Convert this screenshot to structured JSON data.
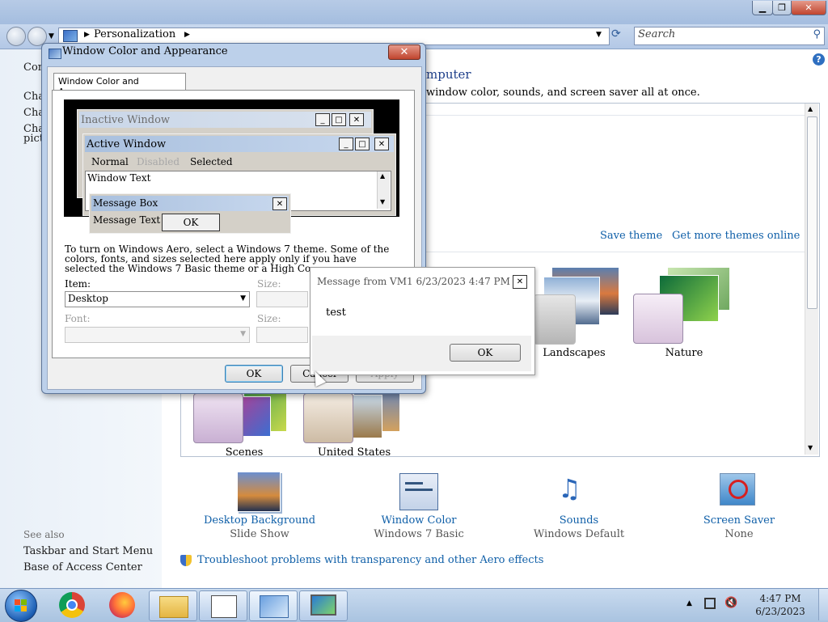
{
  "explorer": {
    "breadcrumb": [
      "Personalization"
    ],
    "search_placeholder": "Search",
    "heading_fragment": "omputer",
    "intro_fragment": "window color, sounds, and screen saver all at once.",
    "left_pane": {
      "items": [
        "Con",
        "Cha",
        "Cha",
        "Cha",
        "pict"
      ],
      "see_also_label": "See also",
      "see_also_links": [
        "Taskbar and Start Menu",
        "Base of Access Center"
      ]
    },
    "theme_links": {
      "save": "Save theme",
      "more": "Get more themes online"
    },
    "themes": [
      {
        "name": "Landscapes"
      },
      {
        "name": "Nature"
      },
      {
        "name": "Scenes"
      },
      {
        "name": "United States"
      }
    ],
    "bottom_items": [
      {
        "title": "Desktop Background",
        "subtitle": "Slide Show",
        "icon": "desktop-background-icon"
      },
      {
        "title": "Window Color",
        "subtitle": "Windows 7 Basic",
        "icon": "window-color-icon"
      },
      {
        "title": "Sounds",
        "subtitle": "Windows Default",
        "icon": "sounds-icon"
      },
      {
        "title": "Screen Saver",
        "subtitle": "None",
        "icon": "screen-saver-icon"
      }
    ],
    "troubleshoot_link": "Troubleshoot problems with transparency and other Aero effects"
  },
  "dialog": {
    "title": "Window Color and Appearance",
    "tab_label": "Window Color and Appearance",
    "preview": {
      "inactive_title": "Inactive Window",
      "active_title": "Active Window",
      "menu_normal": "Normal",
      "menu_disabled": "Disabled",
      "menu_selected": "Selected",
      "window_text": "Window Text",
      "msgbox_title": "Message Box",
      "msgbox_text": "Message Text",
      "msgbox_ok": "OK"
    },
    "info_lines": [
      "To turn on Windows Aero, select a Windows 7 theme.  Some of the",
      "colors, fonts, and sizes selected here apply only if you have",
      "selected the Windows 7 Basic theme or a High Co"
    ],
    "item_label": "Item:",
    "item_value": "Desktop",
    "size_label": "Size:",
    "font_label": "Font:",
    "size2_label": "Size:",
    "ok": "OK",
    "cancel": "Cancel",
    "apply": "Apply"
  },
  "message_popup": {
    "title": "Message from VM1 6/23/2023 4:47 PM",
    "body": "test",
    "ok": "OK"
  },
  "taskbar": {
    "time": "4:47 PM",
    "date": "6/23/2023"
  },
  "colors": {
    "link": "#0f5fa8",
    "titlebar": "#b7cbe6",
    "taskbar": "#b6cde6"
  }
}
